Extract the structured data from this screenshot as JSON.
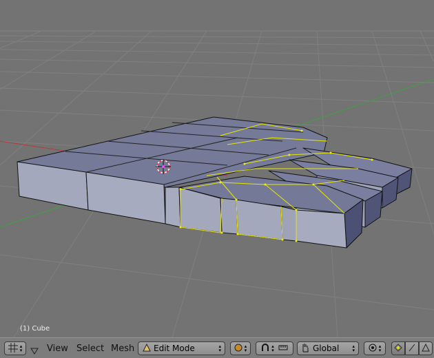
{
  "viewport": {
    "object_label": "(1) Cube"
  },
  "header": {
    "editor_type_icon": "grid-editor-icon",
    "collapse_icon": "triangle-down-icon",
    "menus": [
      "View",
      "Select",
      "Mesh"
    ],
    "mode": {
      "label": "Edit Mode",
      "icon": "edit-mode-triangle-icon"
    },
    "shading_icon": "shading-sphere-icon",
    "pivot_icon": "pivot-magnet-icon",
    "manipulator_icon": "manipulator-ruler-icon",
    "orientation": {
      "label": "Global",
      "icon": "hand-icon"
    },
    "snap_icon": "snap-target-icon",
    "select_modes": [
      "vertex-select-icon",
      "edge-select-icon",
      "face-select-icon"
    ]
  },
  "colors": {
    "viewport_bg": "#737373",
    "grid_line": "#7e7e7e",
    "mesh_face": "#9ca1b8",
    "mesh_top": "#767b99",
    "selection": "#f0f000",
    "vertex_pink": "#ff40ff",
    "x_axis": "#b33b3b",
    "y_axis": "#3fa23f"
  }
}
